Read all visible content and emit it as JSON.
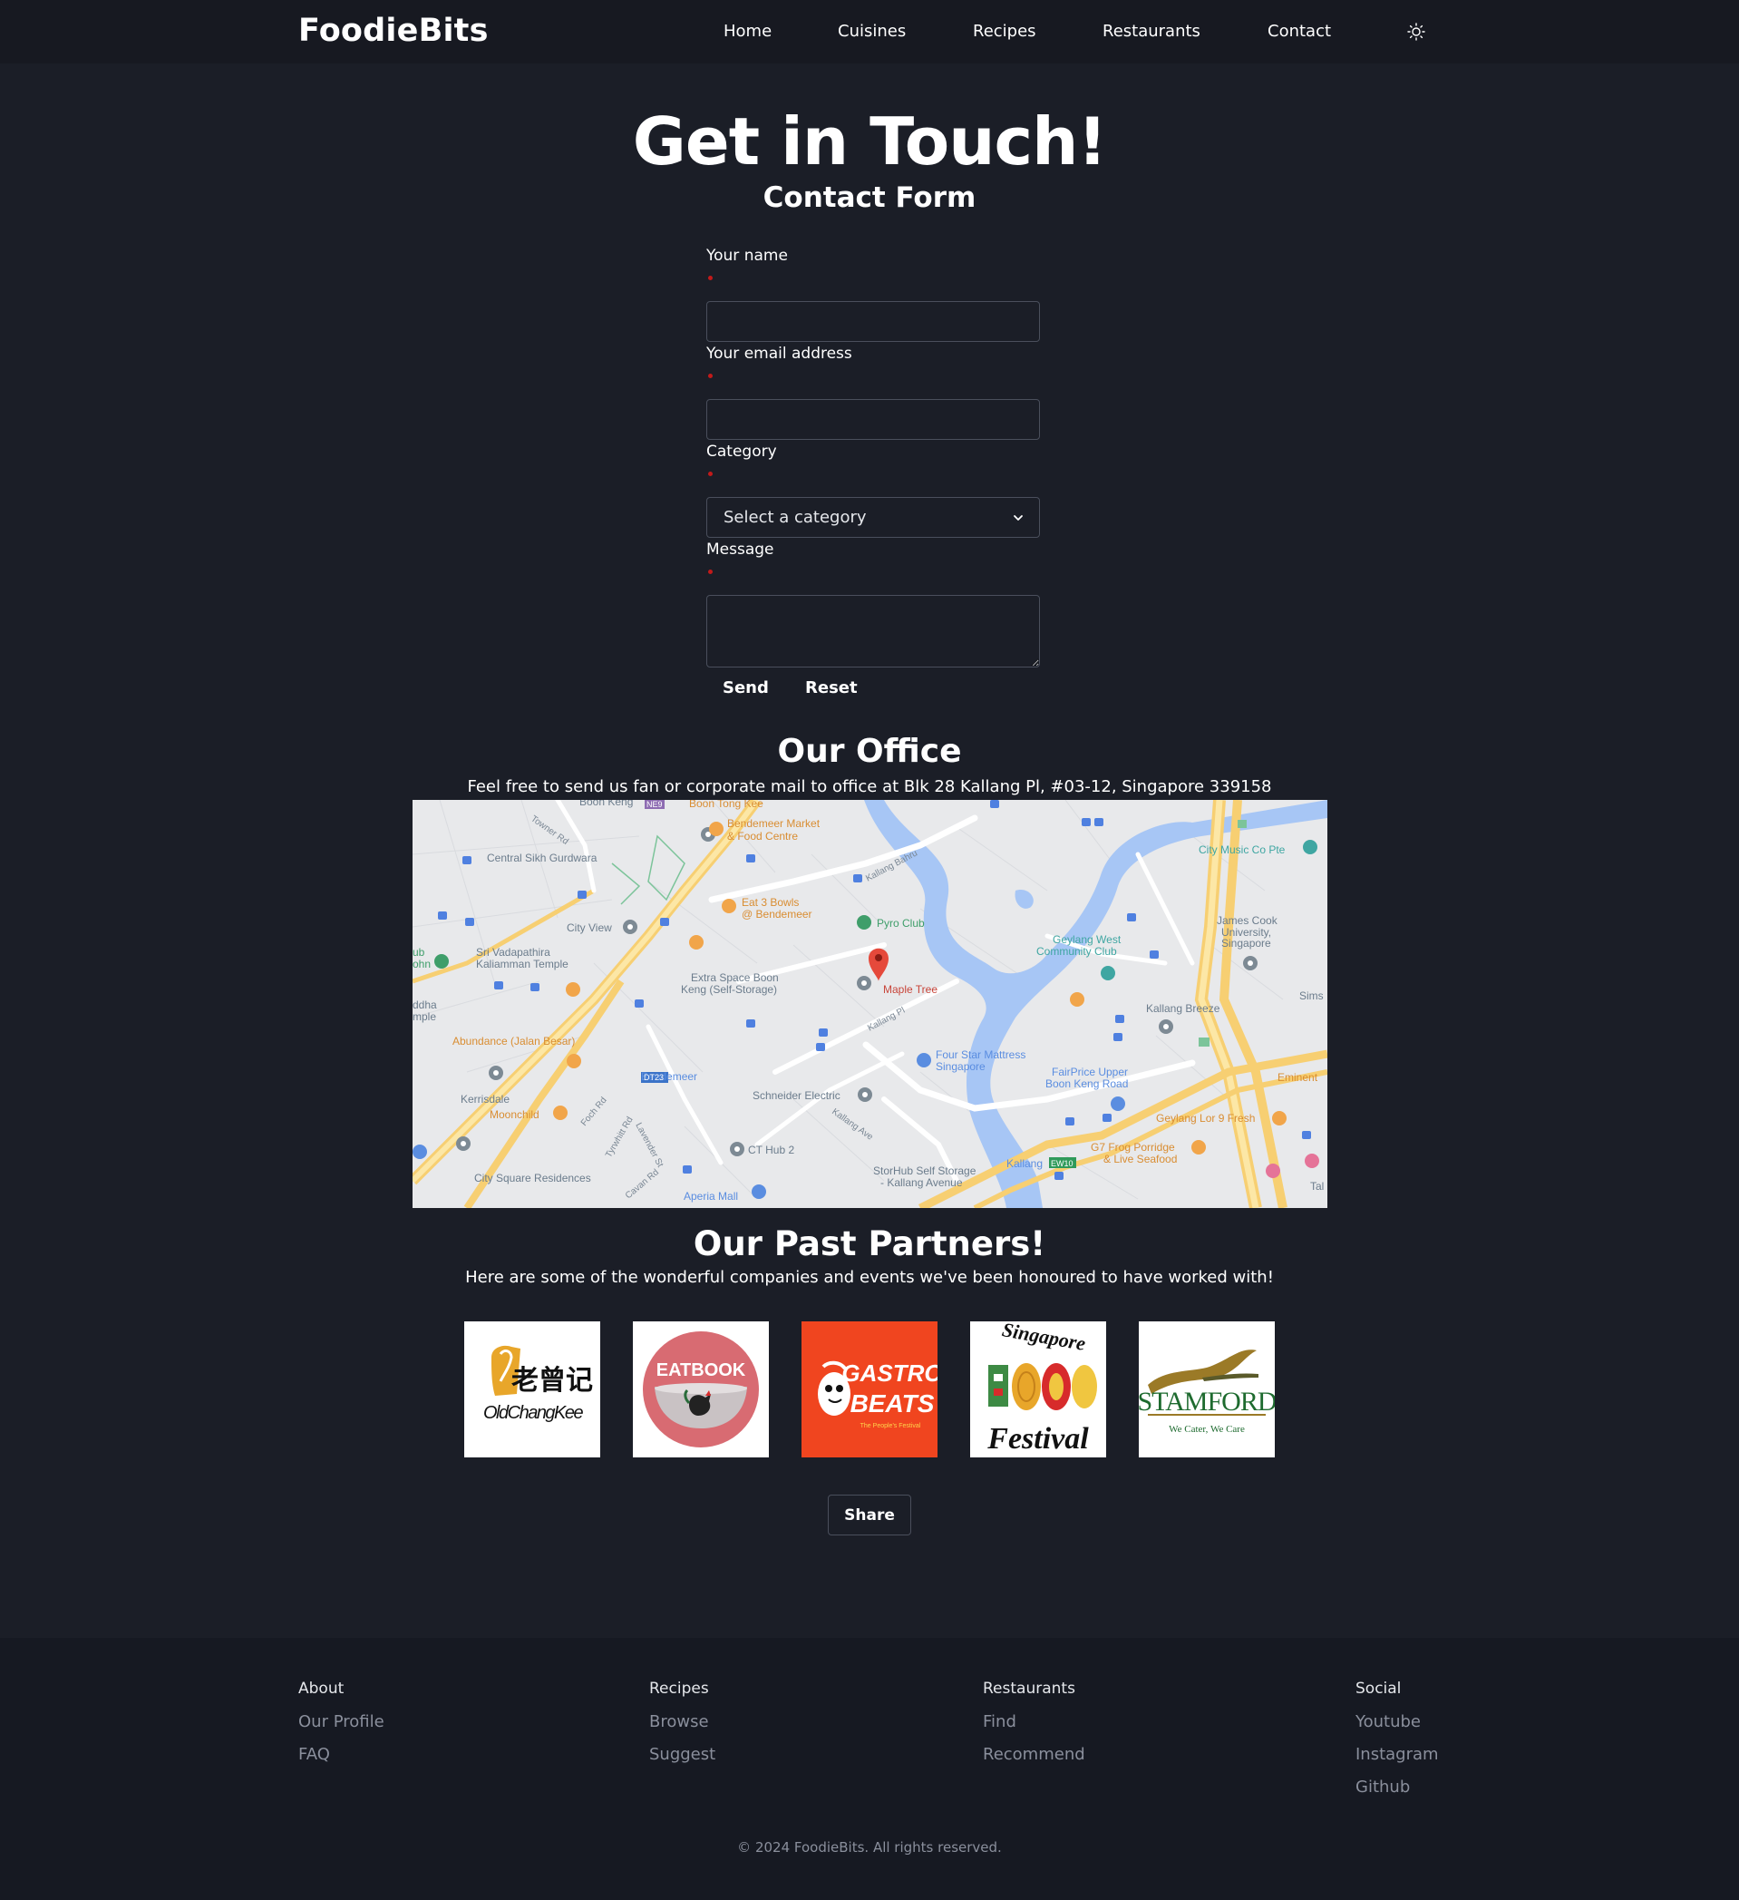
{
  "navbar": {
    "brand": "FoodieBits",
    "links": [
      "Home",
      "Cuisines",
      "Recipes",
      "Restaurants",
      "Contact"
    ],
    "theme_icon": "sun-icon"
  },
  "hero": {
    "title": "Get in Touch!",
    "form_title": "Contact Form"
  },
  "form": {
    "name_label": "Your name",
    "email_label": "Your email address",
    "category_label": "Category",
    "category_value": "Select a category",
    "message_label": "Message",
    "send_label": "Send",
    "reset_label": "Reset"
  },
  "office": {
    "title": "Our Office",
    "text": "Feel free to send us fan or corporate mail to office at Blk 28 Kallang Pl, #03-12, Singapore 339158",
    "map_labels": {
      "boon_keng": "Boon Keng",
      "boon_tong_kee": "Boon Tong Kee",
      "bendemeer_market": "Bendemeer Market",
      "food_centre": "& Food Centre",
      "central_sikh": "Central Sikh Gurdwara",
      "city_music": "City Music Co Pte",
      "eat_3_bowls": "Eat 3 Bowls",
      "at_bendemeer": "@ Bendemeer",
      "pyro_club": "Pyro Club",
      "city_view": "City View",
      "geylang_west": "Geylang West",
      "community_club": "Community Club",
      "james_cook_1": "James Cook",
      "james_cook_2": "University,",
      "james_cook_3": "Singapore",
      "sri_vada_1": "Sri Vadapathira",
      "sri_vada_2": "Kaliamman Temple",
      "extra_space_1": "Extra Space Boon",
      "extra_space_2": "Keng (Self-Storage)",
      "maple_tree": "Maple Tree",
      "kallang_breeze": "Kallang Breeze",
      "abundance": "Abundance (Jalan Besar)",
      "four_star_1": "Four Star Mattress",
      "four_star_2": "Singapore",
      "fairprice_1": "FairPrice Upper",
      "fairprice_2": "Boon Keng Road",
      "bendemeer": "Bendemeer",
      "dt23": "DT23",
      "ne9": "NE9",
      "ew10": "EW10",
      "kerrisdale": "Kerrisdale",
      "schneider": "Schneider Electric",
      "moonchild": "Moonchild",
      "geylang_lor": "Geylang Lor 9 Fresh",
      "ct_hub": "CT Hub 2",
      "g7_frog_1": "G7 Frog Porridge",
      "g7_frog_2": "& Live Seafood",
      "storhub_1": "StorHub Self Storage",
      "storhub_2": "- Kallang Avenue",
      "kallang": "Kallang",
      "city_square": "City Square Residences",
      "aperia": "Aperia Mall",
      "eminent": "Eminent",
      "sims": "Sims",
      "towner_rd": "Towner Rd",
      "kallang_bahru": "Kallang Bahru",
      "kallang_pl": "Kallang Pl",
      "kallang_ave": "Kallang Ave",
      "foch_rd": "Foch Rd",
      "tyrwhitt_rd": "Tyrwhitt Rd",
      "lavender_st": "Lavender St",
      "cavan_rd": "Cavan Rd",
      "hub": "ub",
      "ohn": "ohn",
      "ddha": "ddha",
      "mple": "mple",
      "tal": "Tal"
    }
  },
  "partners": {
    "title": "Our Past Partners!",
    "text": "Here are some of the wonderful companies and events we've been honoured to have worked with!",
    "logos": [
      {
        "name": "Old Chang Kee",
        "chinese": "老曾记",
        "text": "OldChangKee"
      },
      {
        "name": "Eatbook",
        "text": "EATBOOK"
      },
      {
        "name": "Gastro Beats",
        "line1": "GASTRO",
        "line2": "BEATS",
        "tagline": "The People's Festival"
      },
      {
        "name": "Singapore Food Festival",
        "line1": "Singapore",
        "line2": "Festival"
      },
      {
        "name": "Stamford",
        "text": "STAMFORD",
        "tagline": "We Cater, We Care"
      }
    ],
    "share_label": "Share"
  },
  "footer": {
    "columns": [
      {
        "heading": "About",
        "links": [
          "Our Profile",
          "FAQ"
        ]
      },
      {
        "heading": "Recipes",
        "links": [
          "Browse",
          "Suggest"
        ]
      },
      {
        "heading": "Restaurants",
        "links": [
          "Find",
          "Recommend"
        ]
      },
      {
        "heading": "Social",
        "links": [
          "Youtube",
          "Instagram",
          "Github"
        ]
      }
    ],
    "copyright": "© 2024 FoodieBits. All rights reserved."
  },
  "colors": {
    "background": "#1b1e27",
    "navbar": "#171921",
    "footer": "#161922",
    "required_dot": "#c21a1a",
    "muted_text": "#8a8f9c"
  }
}
